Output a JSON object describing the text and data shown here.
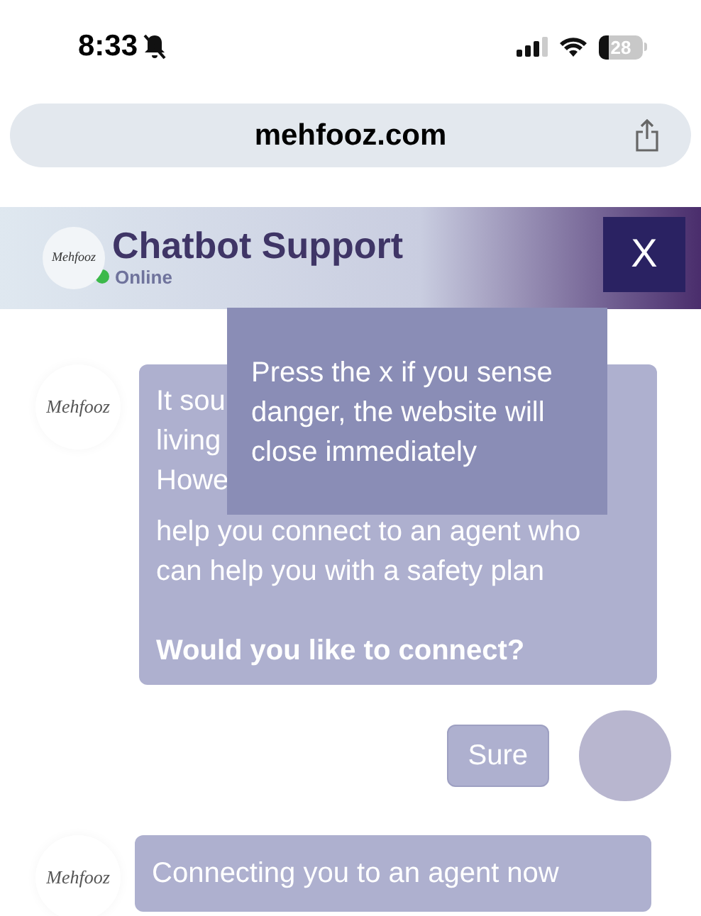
{
  "status_bar": {
    "time": "8:33",
    "battery": "28"
  },
  "address_bar": {
    "url": "mehfooz.com"
  },
  "chat_header": {
    "logo": "Mehfooz",
    "title": "Chatbot Support",
    "status": "Online",
    "close": "X"
  },
  "tooltip": {
    "text": "Press the x if you sense danger, the website will close immediately"
  },
  "messages": [
    {
      "kind": "bot",
      "avatar": "Mehfooz",
      "paragraphs": [
        [
          "It sou",
          "living",
          "Howe",
          "help you connect to an agent who",
          "can help you with a safety plan"
        ],
        [
          "Would you like to connect?"
        ]
      ]
    },
    {
      "kind": "user",
      "text": "Sure"
    },
    {
      "kind": "bot",
      "avatar": "Mehfooz",
      "paragraphs": [
        [
          "Connecting you to an agent now"
        ]
      ]
    }
  ]
}
